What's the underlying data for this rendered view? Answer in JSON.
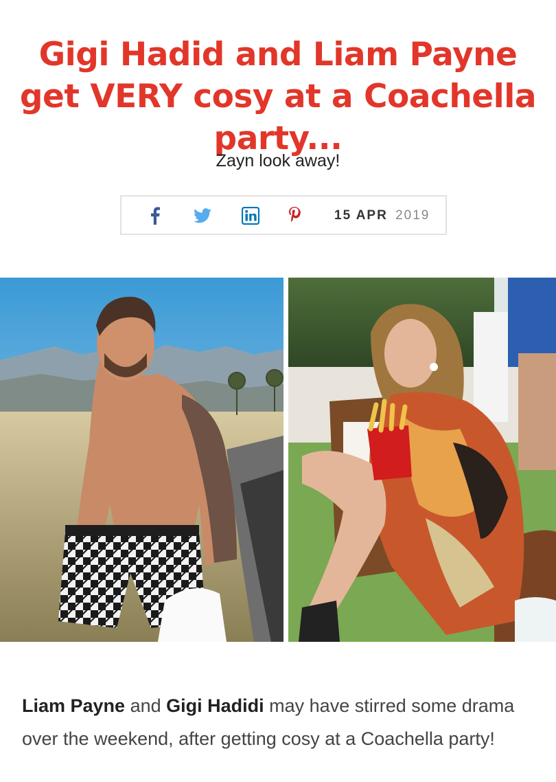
{
  "article": {
    "headline": "Gigi Hadid and Liam Payne get VERY cosy at a Coachella party...",
    "subtitle": "Zayn look away!",
    "date_day_month": "15 APR",
    "date_year": "2019",
    "share_icons": [
      "facebook-icon",
      "twitter-icon",
      "linkedin-icon",
      "pinterest-icon"
    ],
    "body_bold_1": "Liam Payne",
    "body_text_1": " and ",
    "body_bold_2": "Gigi Hadidi",
    "body_text_2": " may have stirred some drama over the weekend, after getting cosy at a Coachella party!"
  },
  "colors": {
    "headline": "#e2362a",
    "facebook": "#3b5998",
    "twitter": "#55acee",
    "linkedin": "#0077b5",
    "pinterest": "#cb2027"
  }
}
